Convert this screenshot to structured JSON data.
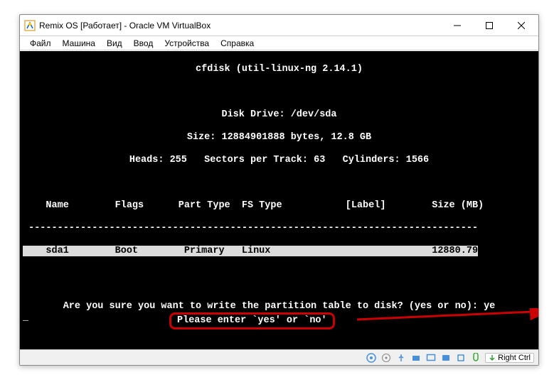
{
  "window": {
    "title": "Remix OS [Работает] - Oracle VM VirtualBox"
  },
  "menu": {
    "file": "Файл",
    "machine": "Машина",
    "view": "Вид",
    "input": "Ввод",
    "devices": "Устройства",
    "help": "Справка"
  },
  "terminal": {
    "header_program": "cfdisk (util-linux-ng 2.14.1)",
    "disk_drive": "Disk Drive: /dev/sda",
    "disk_size": "Size: 12884901888 bytes, 12.8 GB",
    "disk_geom": "Heads: 255   Sectors per Track: 63   Cylinders: 1566",
    "cols": {
      "name": "Name",
      "flags": "Flags",
      "parttype": "Part Type",
      "fstype": "FS Type",
      "label": "[Label]",
      "size": "Size (MB)"
    },
    "row": {
      "name": "sda1",
      "flags": "Boot",
      "parttype": "Primary",
      "fstype": "Linux",
      "label": "",
      "size": "12880.79"
    },
    "prompt": "Are you sure you want to write the partition table to disk? (yes or no): ye",
    "hint": "Please enter `yes' or `no'"
  },
  "statusbar": {
    "hostkey": "Right Ctrl"
  }
}
